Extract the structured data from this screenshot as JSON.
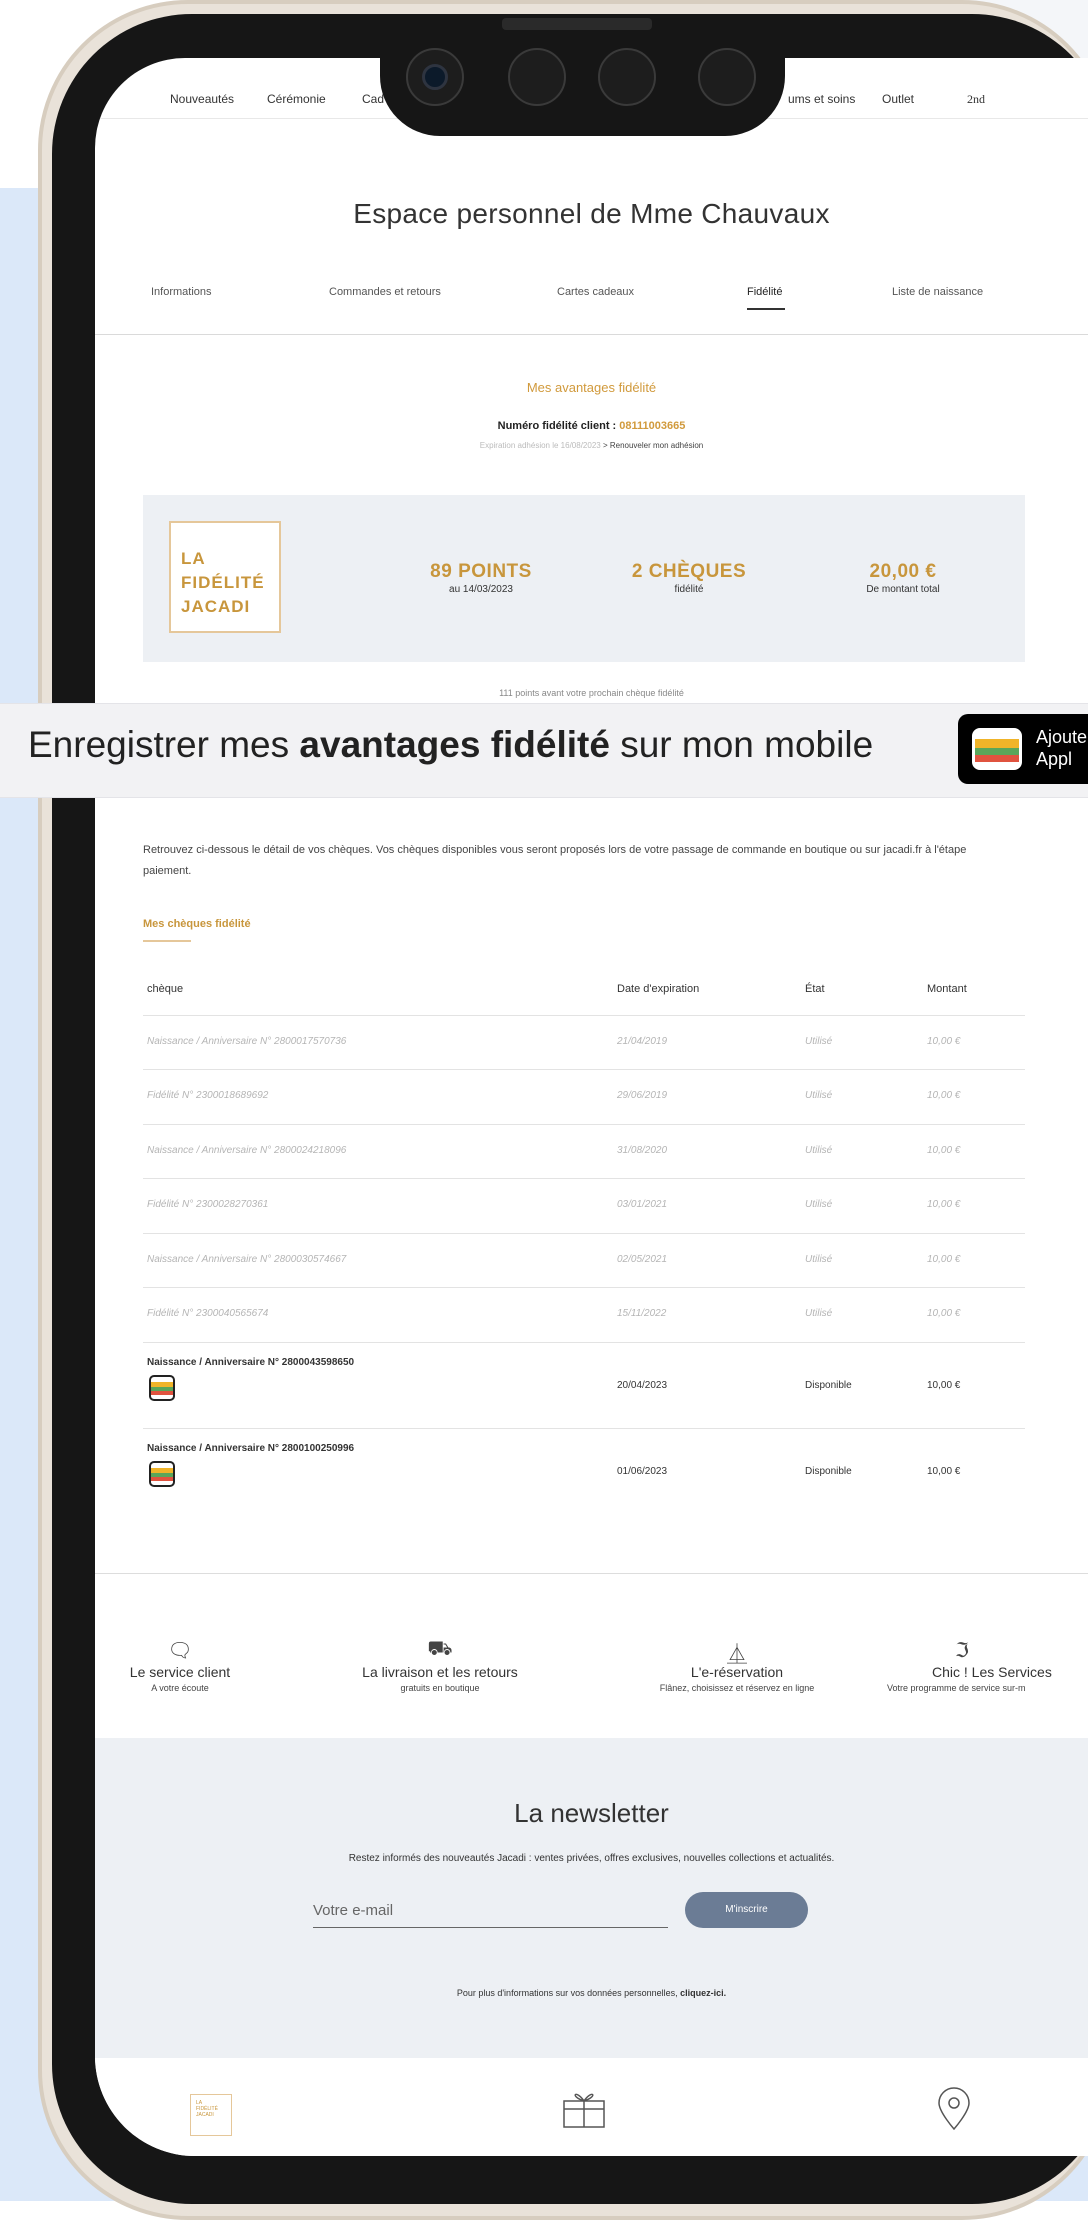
{
  "nav": {
    "items": [
      "Nouveautés",
      "Cérémonie",
      "Cad",
      "ums et soins",
      "Outlet"
    ],
    "brand": "2nd"
  },
  "page_title": "Espace personnel de Mme Chauvaux",
  "tabs": [
    "Informations",
    "Commandes et retours",
    "Cartes cadeaux",
    "Fidélité",
    "Liste de naissance"
  ],
  "active_tab": "Fidélité",
  "fidelity": {
    "title": "Mes avantages fidélité",
    "number_label": "Numéro fidélité client : ",
    "number": "08111003665",
    "expiration": "Expiration adhésion le 16/08/2023",
    "renew": "> Renouveler mon adhésion",
    "logo_lines": [
      "LA",
      "FIDÉLITÉ",
      "JACADI"
    ],
    "points": "89 POINTS",
    "points_date": "au 14/03/2023",
    "cheques": "2 CHÈQUES",
    "cheques_sub": "fidélité",
    "amount": "20,00 €",
    "amount_sub": "De montant total",
    "peek_text": "111 points avant votre prochain chèque fidélité"
  },
  "banner": {
    "text_before": "Enregistrer mes ",
    "text_bold": "avantages fidélité",
    "text_after": " sur mon mobile",
    "wallet_line1": "Ajoute",
    "wallet_line2": "Appl"
  },
  "cheques_section": {
    "intro": "Retrouvez ci-dessous le détail de vos chèques. Vos chèques disponibles vous seront proposés lors de votre passage de commande en boutique ou sur jacadi.fr à l'étape paiement.",
    "title": "Mes chèques fidélité",
    "headers": [
      "chèque",
      "Date d'expiration",
      "État",
      "Montant"
    ],
    "rows": [
      {
        "name": "Naissance / Anniversaire  N° 2800017570736",
        "date": "21/04/2019",
        "state": "Utilisé",
        "amount": "10,00 €"
      },
      {
        "name": "Fidélité N° 2300018689692",
        "date": "29/06/2019",
        "state": "Utilisé",
        "amount": "10,00 €"
      },
      {
        "name": "Naissance / Anniversaire  N° 2800024218096",
        "date": "31/08/2020",
        "state": "Utilisé",
        "amount": "10,00 €"
      },
      {
        "name": "Fidélité N° 2300028270361",
        "date": "03/01/2021",
        "state": "Utilisé",
        "amount": "10,00 €"
      },
      {
        "name": "Naissance / Anniversaire  N° 2800030574667",
        "date": "02/05/2021",
        "state": "Utilisé",
        "amount": "10,00 €"
      },
      {
        "name": "Fidélité N° 2300040565674",
        "date": "15/11/2022",
        "state": "Utilisé",
        "amount": "10,00 €"
      },
      {
        "name": "Naissance / Anniversaire  N° 2800043598650",
        "date": "20/04/2023",
        "state": "Disponible",
        "amount": "10,00 €"
      },
      {
        "name": "Naissance / Anniversaire  N° 2800100250996",
        "date": "01/06/2023",
        "state": "Disponible",
        "amount": "10,00 €"
      }
    ]
  },
  "services": [
    {
      "icon": "chat-bubble-icon",
      "title": "Le service client",
      "sub": "A votre écoute"
    },
    {
      "icon": "truck-icon",
      "title": "La livraison et les retours",
      "sub": "gratuits en boutique"
    },
    {
      "icon": "hanger-icon",
      "title": "L'e-réservation",
      "sub": "Flânez, choisissez et réservez en ligne"
    },
    {
      "icon": "iron-icon",
      "title": "Chic ! Les Services",
      "sub": "Votre programme de service sur-m"
    }
  ],
  "newsletter": {
    "title": "La newsletter",
    "text": "Restez informés des nouveautés Jacadi : ventes privées, offres exclusives, nouvelles collections et actualités.",
    "placeholder": "Votre e-mail",
    "button": "M'inscrire",
    "info": "Pour plus d'informations sur vos données personnelles, ",
    "info_link": "cliquez-ici."
  },
  "bottom_bar": {
    "logo_lines": [
      "LA",
      "FIDÉLITÉ",
      "JACADI"
    ],
    "icons": [
      "fidelity-logo-icon",
      "gift-icon",
      "location-pin-icon"
    ]
  },
  "colors": {
    "gold": "#c8963c",
    "summary_bg": "#edf0f4",
    "button_blue": "#6b7c95",
    "background_blue": "#dbe8f9"
  }
}
